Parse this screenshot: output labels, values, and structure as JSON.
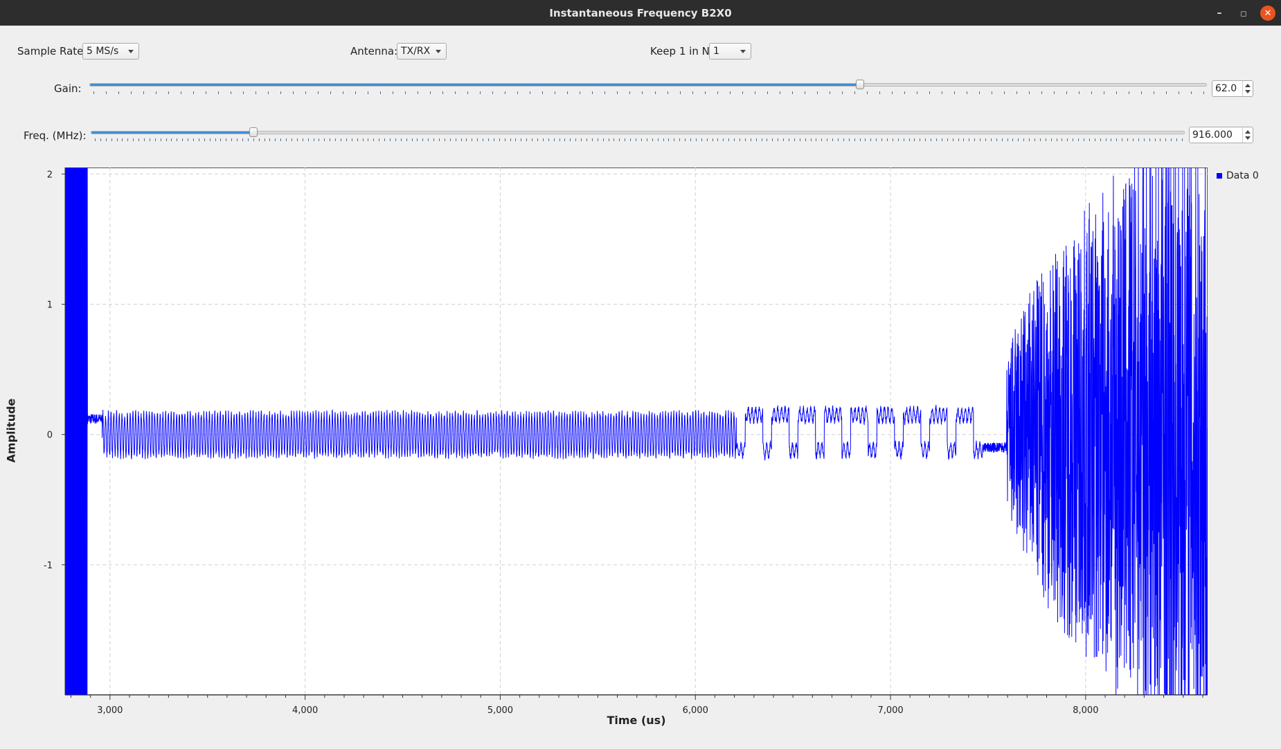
{
  "window": {
    "title": "Instantaneous Frequency B2X0",
    "min_glyph": "–",
    "max_glyph": "◻",
    "close_glyph": "✕"
  },
  "controls": {
    "sample_rate": {
      "label": "Sample Rate:",
      "value": "5 MS/s"
    },
    "antenna": {
      "label": "Antenna:",
      "value": "TX/RX"
    },
    "keep": {
      "label": "Keep 1 in N:",
      "value": "1"
    },
    "gain": {
      "label": "Gain:",
      "value": "62.0",
      "level_fraction": 0.689
    },
    "freq": {
      "label": "Freq. (MHz):",
      "value": "916.000",
      "level_fraction": 0.148
    }
  },
  "colors": {
    "trace": "#0000ff",
    "grid": "#d0d0d0"
  },
  "chart_data": {
    "type": "line",
    "xlabel": "Time (us)",
    "ylabel": "Amplitude",
    "xlim": [
      2770,
      8625
    ],
    "ylim": [
      -2.0,
      2.05
    ],
    "xticks": [
      3000,
      4000,
      5000,
      6000,
      7000,
      8000
    ],
    "xtick_labels": [
      "3,000",
      "4,000",
      "5,000",
      "6,000",
      "7,000",
      "8,000"
    ],
    "yticks": [
      2,
      1,
      0,
      -1
    ],
    "ytick_labels": [
      "2",
      "1",
      "0",
      "-1"
    ],
    "grid": true,
    "legend": {
      "position": "right",
      "entries": [
        "Data 0"
      ]
    },
    "series": [
      {
        "name": "Data 0",
        "segments": [
          {
            "x_start": 2770,
            "x_end": 2885,
            "kind": "saturated",
            "y_min": -2.0,
            "y_max": 2.05
          },
          {
            "x_start": 2885,
            "x_end": 2960,
            "kind": "flat",
            "y_center": 0.12,
            "amplitude": 0.04
          },
          {
            "x_start": 2960,
            "x_end": 6210,
            "kind": "oscillation",
            "y_center": 0.0,
            "amplitude": 0.16,
            "period_us": 14
          },
          {
            "x_start": 6210,
            "x_end": 7470,
            "kind": "burst",
            "low": -0.12,
            "high": 0.15
          },
          {
            "x_start": 7470,
            "x_end": 7595,
            "kind": "flat",
            "y_center": -0.1,
            "amplitude": 0.04
          },
          {
            "x_start": 7595,
            "x_end": 8625,
            "kind": "noise",
            "start_amplitude": 0.4,
            "end_amplitude": 2.05
          }
        ]
      }
    ]
  }
}
